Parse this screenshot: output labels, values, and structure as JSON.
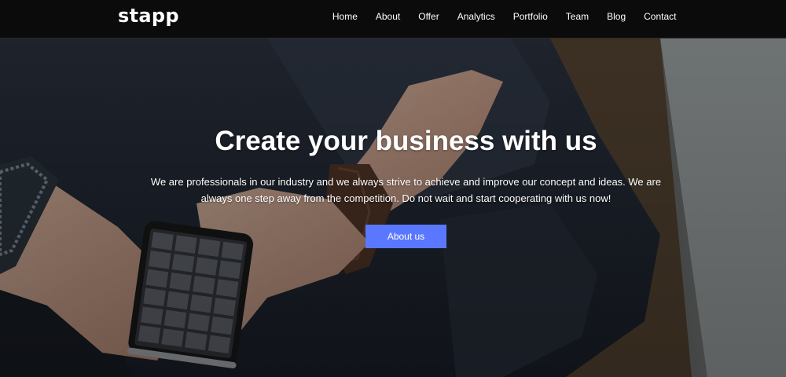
{
  "navbar": {
    "brand": "stapp",
    "links": [
      "Home",
      "About",
      "Offer",
      "Analytics",
      "Portfolio",
      "Team",
      "Blog",
      "Contact"
    ]
  },
  "hero": {
    "title": "Create your business with us",
    "text": "We are professionals in our industry and we always strive to achieve and improve our concept and ideas. We are always one step away from the competition. Do not wait and start cooperating with us now!",
    "button_label": "About us",
    "accent_color": "#5a78ff",
    "background_image": "hands holding smartphone with photo gallery, denim jeans, leather bracelet"
  }
}
